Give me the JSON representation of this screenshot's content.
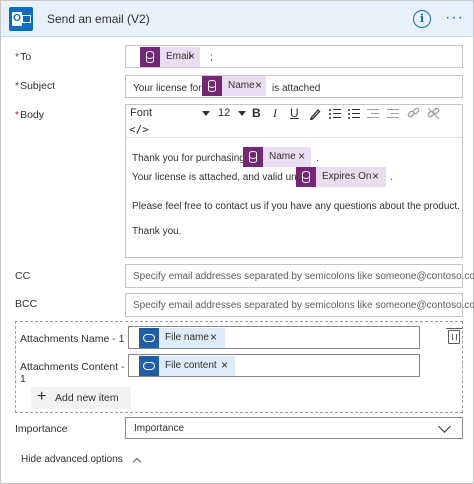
{
  "header": {
    "title": "Send an email (V2)",
    "app_icon": "outlook-icon",
    "info_icon": "info-icon",
    "more_icon": "more-options-icon",
    "info_glyph": "i",
    "more_glyph": "···"
  },
  "to": {
    "label": "To",
    "required_mark": "*",
    "token": "Email",
    "after": ";"
  },
  "subject": {
    "label": "Subject",
    "required_mark": "*",
    "prefix": "Your license for",
    "token": "Name",
    "suffix": "is attached"
  },
  "body": {
    "label": "Body",
    "required_mark": "*",
    "toolbar": {
      "font": "Font",
      "size": "12",
      "bold": "B",
      "italic": "I",
      "underline": "U",
      "code_view": "</>"
    },
    "line1_prefix": "Thank you for purchasing",
    "line1_token": "Name",
    "line1_suffix": ".",
    "line2_prefix": "Your license is attached, and valid until",
    "line2_token": "Expires On",
    "line2_suffix": ".",
    "line3": "Please feel free to contact us if you have any questions about the product.",
    "line4": "Thank you."
  },
  "cc": {
    "label": "CC",
    "placeholder": "Specify email addresses separated by semicolons like someone@contoso.com"
  },
  "bcc": {
    "label": "BCC",
    "placeholder": "Specify email addresses separated by semicolons like someone@contoso.com"
  },
  "attachments": {
    "name_label": "Attachments Name - 1",
    "name_token": "File name",
    "content_label_line1": "Attachments Content -",
    "content_label_line2": "1",
    "content_token": "File content",
    "add_label": "Add new item",
    "add_glyph": "+"
  },
  "importance": {
    "label": "Importance",
    "value": "Importance"
  },
  "advanced": {
    "label": "Hide advanced options"
  },
  "token_close": "×",
  "colors": {
    "accent": "#0f6cbd",
    "header_bg": "#e8f1fb",
    "token_bg": "#eaddf2",
    "token_icon": "#742774",
    "file_token_bg": "#deecf9",
    "file_token_icon": "#1f5fa8",
    "required": "#a4262c"
  }
}
